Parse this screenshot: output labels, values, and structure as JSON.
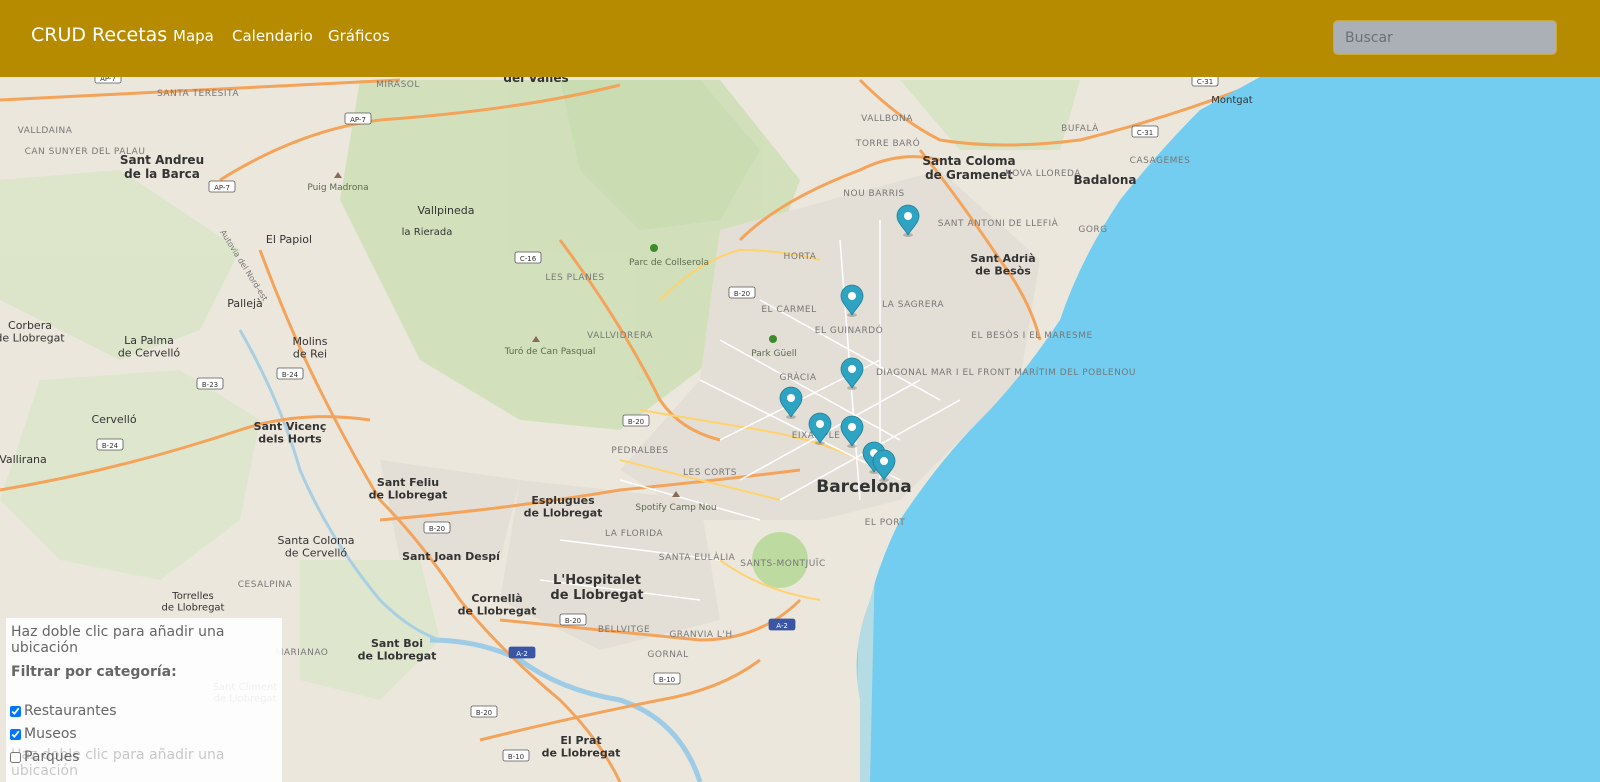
{
  "navbar": {
    "brand": "CRUD Recetas",
    "links": [
      "Mapa",
      "Calendario",
      "Gráficos"
    ],
    "search_placeholder": "Buscar",
    "bg_color": "#b78b00"
  },
  "map": {
    "main_city": "Barcelona",
    "places": [
      "Santa Coloma de Gramenet",
      "Badalona",
      "Sant Adrià de Besòs",
      "Sant Andreu de la Barca",
      "El Papiol",
      "Pallejà",
      "Molins de Rei",
      "Sant Vicenç dels Horts",
      "Sant Feliu de Llobregat",
      "Esplugues de Llobregat",
      "Sant Joan Despí",
      "Cornellà de Llobregat",
      "L'Hospitalet de Llobregat",
      "Sant Boi de Llobregat",
      "El Prat de Llobregat",
      "Santa Coloma de Cervelló",
      "Torrelles de Llobregat",
      "Corbera de Llobregat",
      "La Palma de Cervelló",
      "Cervelló",
      "Vallirana",
      "Vallpineda",
      "la Rierada",
      "Montgat",
      "del Vallès",
      "Sant Climent de Llobregat"
    ],
    "pois": [
      "Parc de Collserola",
      "Park Güell",
      "Turó de Can Pasqual",
      "Puig Madrona",
      "Spotify Camp Nou"
    ],
    "neighborhoods": [
      "HORTA",
      "EL CARMEL",
      "EL GUINARDÓ",
      "GRÀCIA",
      "EIXAMPLE",
      "LES CORTS",
      "PEDRALBES",
      "LA FLORIDA",
      "SANTA EULÀLIA",
      "SANTS-MONTJUÏC",
      "BELLVITGE",
      "GORNAL",
      "GRANVIA L'H",
      "VALLVIDRERA",
      "LES PLANES",
      "LA SAGRERA",
      "NOU BARRIS",
      "VALLBONA",
      "TORRE BARÓ",
      "SANT ANTONI DE LLEFIÀ",
      "NOVA LLOREDA",
      "BUFALÀ",
      "CASAGEMES",
      "GORG",
      "EL BESÒS I EL MARESME",
      "DIAGONAL MAR I EL FRONT MARÍTIM DEL POBLENOU",
      "VALLDAINA",
      "CAN SUNYER DEL PALAU",
      "SANTA TERESITA",
      "MIRASOL",
      "CESALPINA",
      "MARIANAO",
      "EL PORT"
    ],
    "road_labels": [
      "AP-7",
      "AP-7",
      "AP-7",
      "C-16",
      "B-20",
      "B-20",
      "B-20",
      "B-20",
      "B-23",
      "B-24",
      "B-24",
      "A-2",
      "A-2",
      "B-10",
      "B-10",
      "C-31",
      "C-31",
      "B-20"
    ],
    "markers": 8,
    "marker_color": "#2fa4c2",
    "sea_color": "#72cdf0",
    "road_texts": [
      "Autovia del Nord-est"
    ]
  },
  "panel": {
    "hint": "Haz doble clic para añadir una ubicación",
    "filter_title": "Filtrar por categoría:",
    "categories": [
      {
        "label": "Restaurantes",
        "checked": true
      },
      {
        "label": "Museos",
        "checked": true
      },
      {
        "label": "Parques",
        "checked": false
      }
    ],
    "ghost_hint": "Haz doble clic para añadir una ubicación"
  }
}
